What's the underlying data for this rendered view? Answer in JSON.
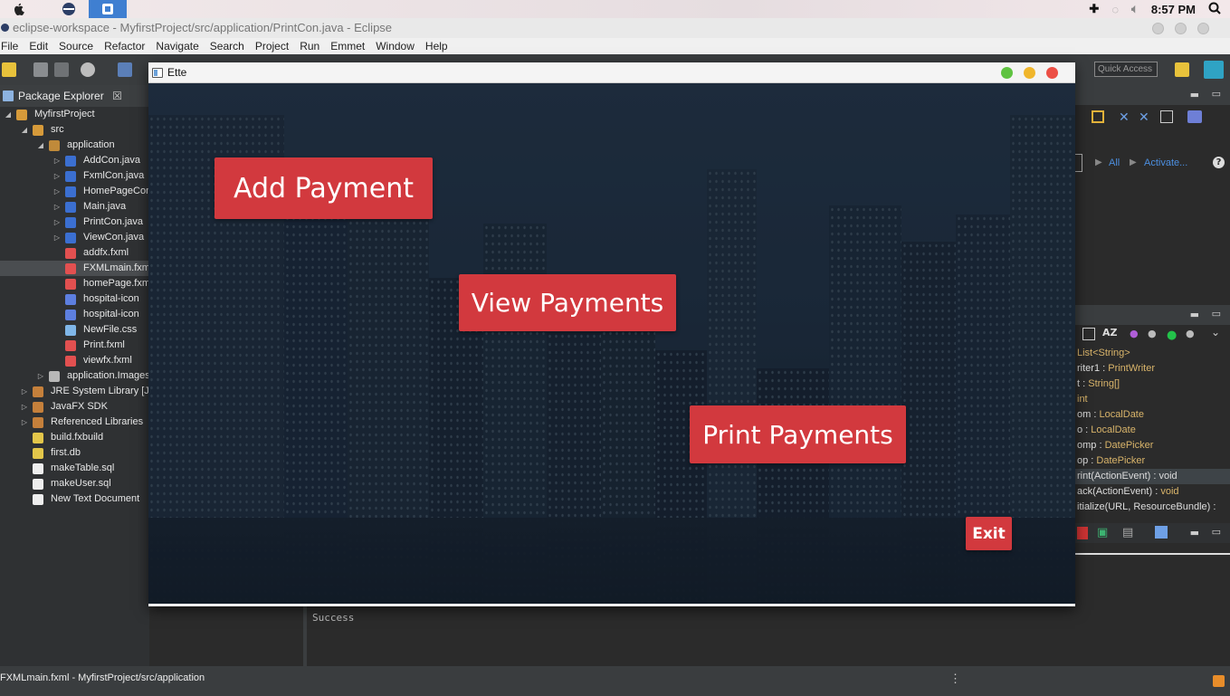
{
  "menubar_top": {
    "time": "8:57 PM"
  },
  "eclipse": {
    "window_title": "eclipse-workspace - MyfirstProject/src/application/PrintCon.java - Eclipse",
    "menu": [
      "File",
      "Edit",
      "Source",
      "Refactor",
      "Navigate",
      "Search",
      "Project",
      "Run",
      "Emmet",
      "Window",
      "Help"
    ],
    "quick_access": "Quick Access"
  },
  "package_explorer": {
    "title": "Package Explorer",
    "close": "☒",
    "items": [
      {
        "label": "MyfirstProject"
      },
      {
        "label": "src"
      },
      {
        "label": "application"
      },
      {
        "label": "AddCon.java"
      },
      {
        "label": "FxmlCon.java"
      },
      {
        "label": "HomePageCon.java"
      },
      {
        "label": "Main.java"
      },
      {
        "label": "PrintCon.java"
      },
      {
        "label": "ViewCon.java"
      },
      {
        "label": "addfx.fxml"
      },
      {
        "label": "FXMLmain.fxml"
      },
      {
        "label": "homePage.fxml"
      },
      {
        "label": "hospital-icon"
      },
      {
        "label": "hospital-icon"
      },
      {
        "label": "NewFile.css"
      },
      {
        "label": "Print.fxml"
      },
      {
        "label": "viewfx.fxml"
      },
      {
        "label": "application.Images"
      },
      {
        "label": "JRE System Library [JavaSE]"
      },
      {
        "label": "JavaFX SDK"
      },
      {
        "label": "Referenced Libraries"
      },
      {
        "label": "build.fxbuild"
      },
      {
        "label": "first.db"
      },
      {
        "label": "makeTable.sql"
      },
      {
        "label": "makeUser.sql"
      },
      {
        "label": "New Text Document"
      }
    ]
  },
  "right_panel": {
    "all_link": "All",
    "activate_link": "Activate...",
    "outline": [
      {
        "name": "",
        "type": "List<String>"
      },
      {
        "name": "riter1 : ",
        "type": "PrintWriter"
      },
      {
        "name": "t : ",
        "type": "String[]"
      },
      {
        "name": "",
        "type": "int"
      },
      {
        "name": "om : ",
        "type": "LocalDate"
      },
      {
        "name": "o : ",
        "type": "LocalDate"
      },
      {
        "name": "omp : ",
        "type": "DatePicker"
      },
      {
        "name": "op : ",
        "type": "DatePicker"
      },
      {
        "name": "rint(ActionEvent) : void",
        "type": ""
      },
      {
        "name": "ack(ActionEvent) : ",
        "type": "void"
      },
      {
        "name": "itialize(URL, ResourceBundle) : ",
        "type": ""
      }
    ]
  },
  "console": {
    "text": "Success"
  },
  "status": {
    "text": "FXMLmain.fxml - MyfirstProject/src/application"
  },
  "app": {
    "title": "Ette",
    "buttons": {
      "add": "Add Payment",
      "view": "View Payments",
      "print": "Print Payments",
      "exit": "Exit"
    }
  }
}
